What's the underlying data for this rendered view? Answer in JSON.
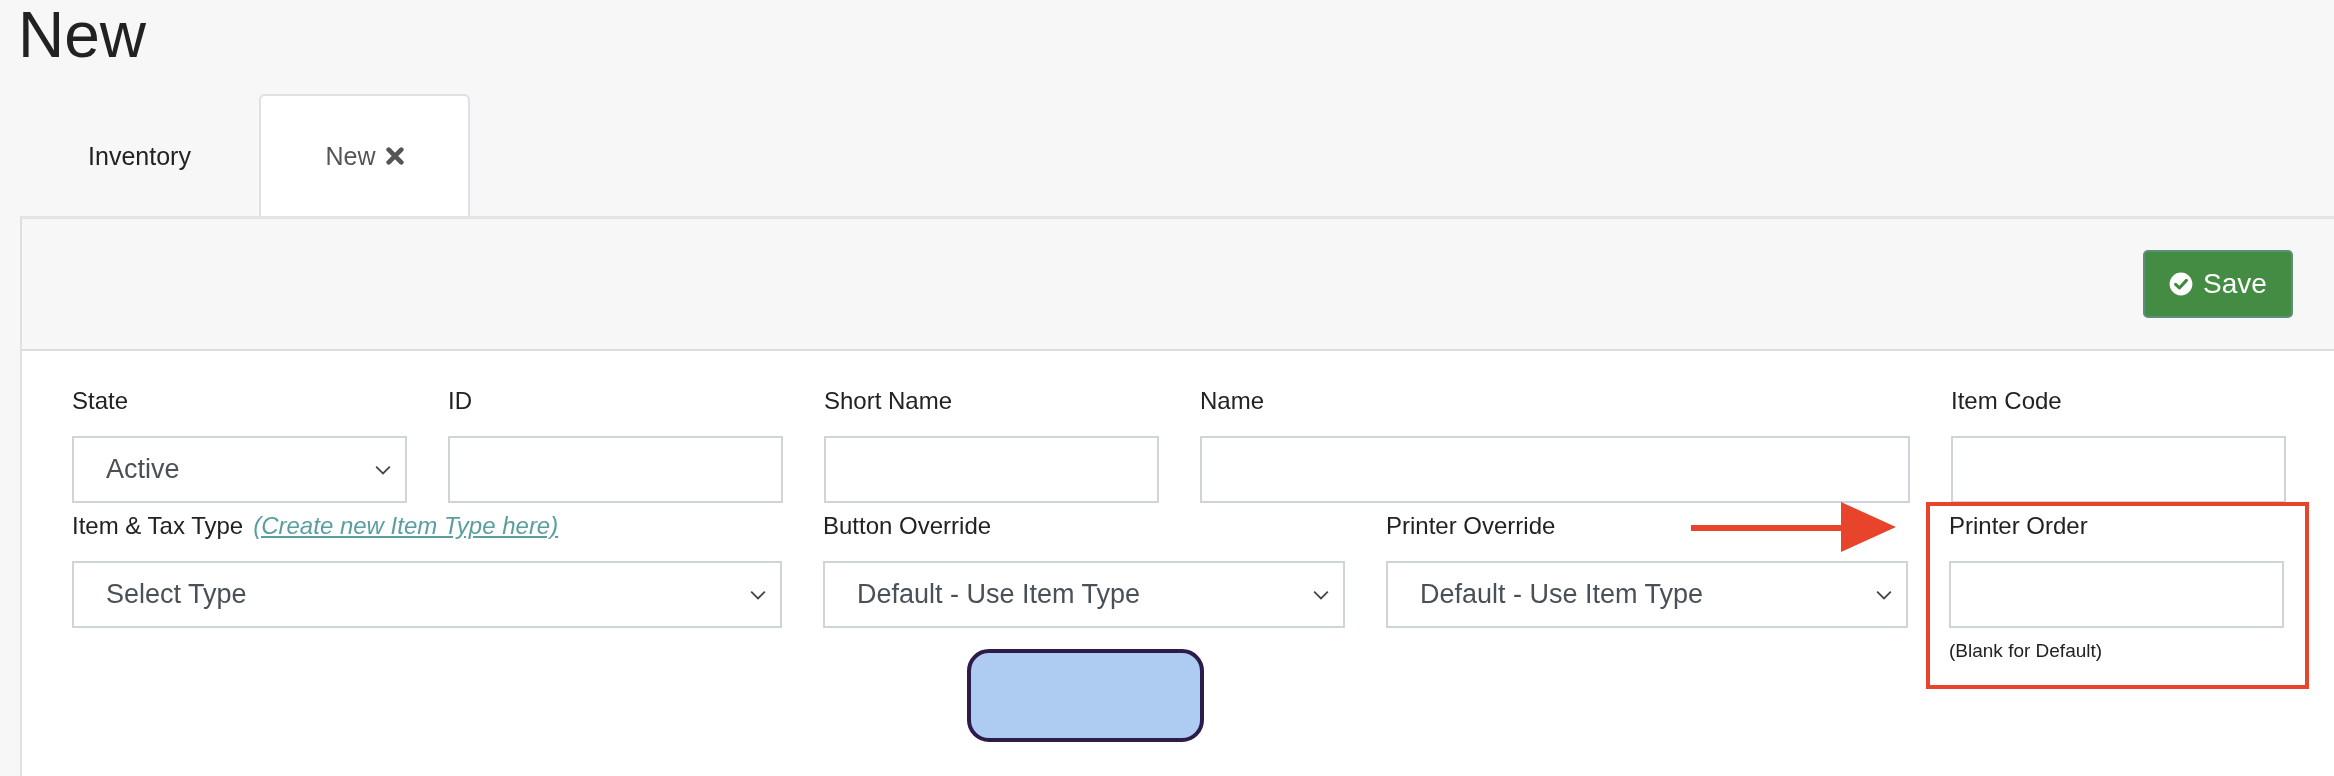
{
  "page_title": "New",
  "tabs": [
    {
      "label": "Inventory",
      "selected": false,
      "closable": false
    },
    {
      "label": "New",
      "selected": true,
      "closable": true
    }
  ],
  "toolbar": {
    "save_button": "Save"
  },
  "form": {
    "fields": [
      {
        "kind": "select",
        "label": "State",
        "value": "Active"
      },
      {
        "kind": "text",
        "label": "ID"
      },
      {
        "kind": "text",
        "label": "Short Name"
      },
      {
        "kind": "text",
        "label": "Name"
      },
      {
        "kind": "text",
        "label": "Item Code"
      },
      {
        "kind": "select",
        "label": "Item & Tax Type",
        "link": "(Create new Item Type here)",
        "value": "Select Type"
      },
      {
        "kind": "select",
        "label": "Button Override",
        "value": "Default - Use Item Type"
      },
      {
        "kind": "select",
        "label": "Printer Override",
        "value": "Default - Use Item Type"
      },
      {
        "kind": "text",
        "label": "Printer Order",
        "hint": "(Blank for Default)",
        "highlighted": true
      }
    ]
  },
  "redaction_block": true
}
